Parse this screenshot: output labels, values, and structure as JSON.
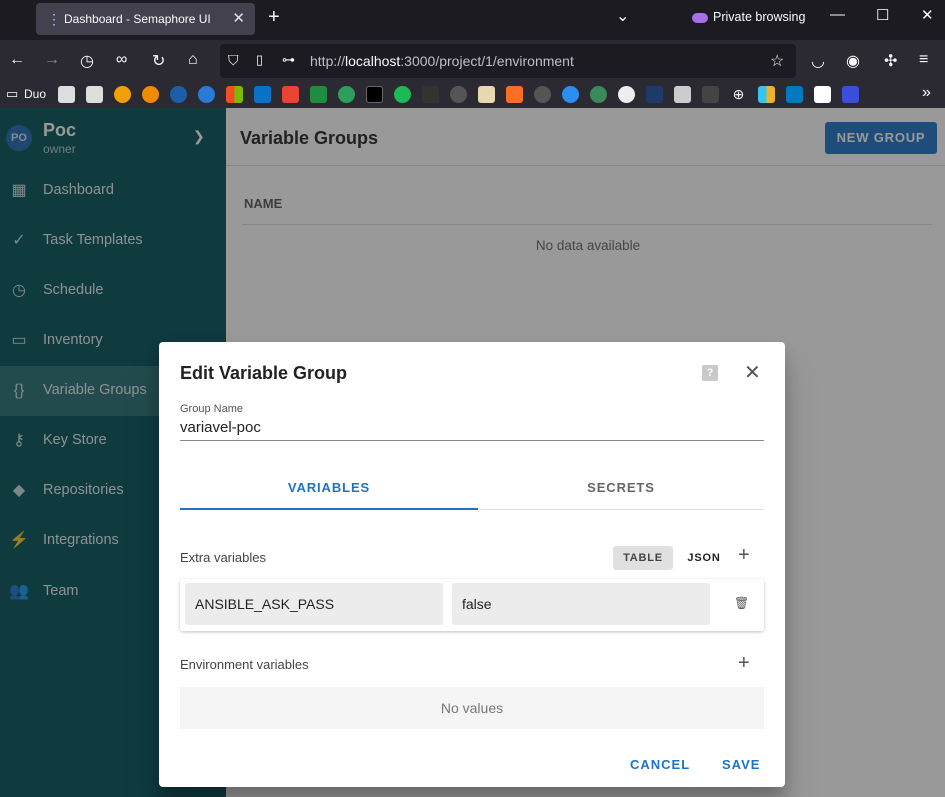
{
  "browser": {
    "tab_title": "Dashboard - Semaphore UI",
    "private_label": "Private browsing",
    "url_prefix": "http://",
    "url_host": "localhost",
    "url_rest": ":3000/project/1/environment",
    "bookmark_folder": "Duo"
  },
  "project": {
    "avatar": "PO",
    "name": "Poc",
    "role": "owner"
  },
  "sidebar": {
    "items": [
      {
        "label": "Dashboard",
        "icon": "dashboard-icon"
      },
      {
        "label": "Task Templates",
        "icon": "check-all-icon"
      },
      {
        "label": "Schedule",
        "icon": "clock-icon"
      },
      {
        "label": "Inventory",
        "icon": "monitor-icon"
      },
      {
        "label": "Variable Groups",
        "icon": "braces-icon"
      },
      {
        "label": "Key Store",
        "icon": "key-icon"
      },
      {
        "label": "Repositories",
        "icon": "git-icon"
      },
      {
        "label": "Integrations",
        "icon": "connection-icon"
      },
      {
        "label": "Team",
        "icon": "team-icon"
      }
    ]
  },
  "page": {
    "title": "Variable Groups",
    "new_button": "NEW GROUP",
    "column_name": "NAME",
    "empty_text": "No data available"
  },
  "dialog": {
    "title": "Edit Variable Group",
    "help": "?",
    "group_name_label": "Group Name",
    "group_name_value": "variavel-poc",
    "tab_variables": "VARIABLES",
    "tab_secrets": "SECRETS",
    "extra_vars_label": "Extra variables",
    "view_table": "TABLE",
    "view_json": "JSON",
    "extra_vars": [
      {
        "name": "ANSIBLE_ASK_PASS",
        "value": "false"
      }
    ],
    "env_vars_label": "Environment variables",
    "env_empty": "No values",
    "cancel": "CANCEL",
    "save": "SAVE"
  },
  "colors": {
    "sidebar": "#005057",
    "accent": "#1f73c7"
  }
}
